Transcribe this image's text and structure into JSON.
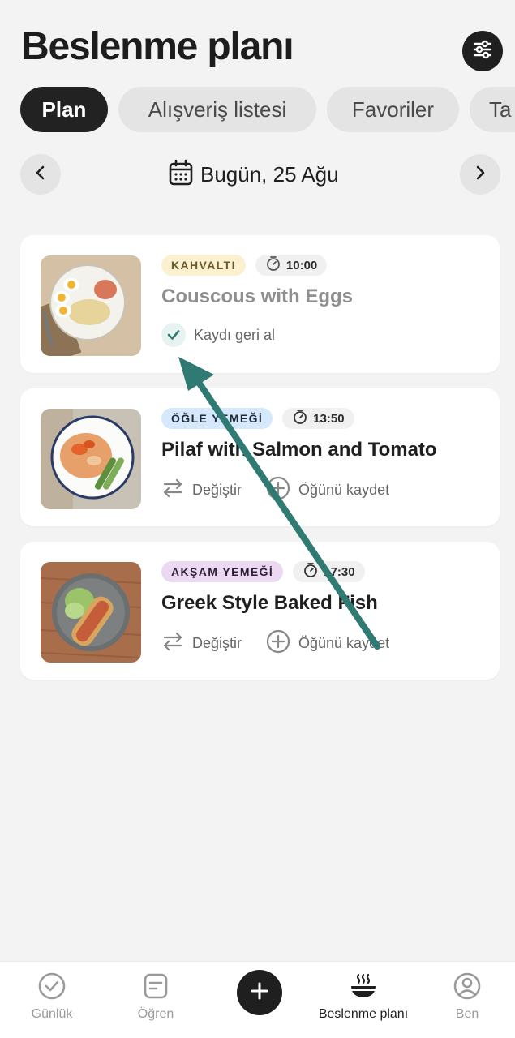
{
  "header": {
    "title": "Beslenme planı",
    "filter_icon": "sliders-icon"
  },
  "tabs": [
    {
      "label": "Plan"
    },
    {
      "label": "Alışveriş listesi"
    },
    {
      "label": "Favoriler"
    },
    {
      "label": "Ta"
    }
  ],
  "datebar": {
    "date": "Bugün, 25 Ağu",
    "prev_icon": "chevron-left-icon",
    "next_icon": "chevron-right-icon",
    "calendar_icon": "calendar-icon"
  },
  "meals": [
    {
      "type": "KAHVALTI",
      "type_bg": "#fbf0cf",
      "type_color": "#6b5a2a",
      "time": "10:00",
      "title": "Couscous with Eggs",
      "logged": true,
      "undo_label": "Kaydı geri al"
    },
    {
      "type": "ÖĞLE YEMEĞİ",
      "type_bg": "#d6e8fb",
      "type_color": "#1c2a3a",
      "time": "13:50",
      "title": "Pilaf with Salmon and Tomato",
      "logged": false,
      "swap_label": "Değiştir",
      "log_label": "Öğünü kaydet"
    },
    {
      "type": "AKŞAM YEMEĞİ",
      "type_bg": "#ead9f1",
      "type_color": "#2f1e36",
      "time": "17:30",
      "title": "Greek Style Baked Fish",
      "logged": false,
      "swap_label": "Değiştir",
      "log_label": "Öğünü kaydet"
    }
  ],
  "bottom_nav": [
    {
      "label": "Günlük",
      "icon": "check-circle-icon"
    },
    {
      "label": "Öğren",
      "icon": "document-icon"
    },
    {
      "label": "",
      "icon": "plus-icon"
    },
    {
      "label": "Beslenme planı",
      "icon": "bowl-icon",
      "active": true
    },
    {
      "label": "Ben",
      "icon": "user-icon"
    }
  ],
  "colors": {
    "accent": "#2f7a73",
    "arrow": "#2f7a73",
    "dark": "#1f1f1f"
  }
}
